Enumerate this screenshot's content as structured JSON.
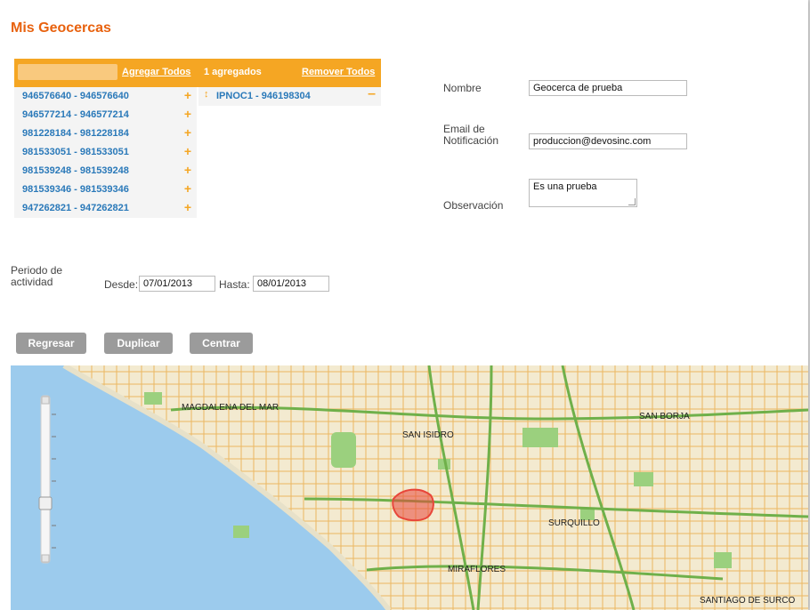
{
  "page_title": "Mis Geocercas",
  "picker": {
    "add_all": "Agregar Todos",
    "count": "1 agregados",
    "remove_all": "Remover Todos",
    "available": [
      "946576640 - 946576640",
      "946577214 - 946577214",
      "981228184 - 981228184",
      "981533051 - 981533051",
      "981539248 - 981539248",
      "981539346 - 981539346",
      "947262821 - 947262821"
    ],
    "selected": [
      "IPNOC1 - 946198304"
    ],
    "add_icon": "+",
    "remove_icon": "–",
    "move_icon": "↕",
    "accent_color": "#f5a623",
    "link_color": "#2a79b9"
  },
  "form": {
    "name_label": "Nombre",
    "name_value": "Geocerca de prueba",
    "email_label_1": "Email de",
    "email_label_2": "Notificación",
    "email_value": "produccion@devosinc.com",
    "obs_label": "Observación",
    "obs_value": "Es una prueba"
  },
  "period": {
    "label_1": "Periodo de",
    "label_2": "actividad",
    "from_label": "Desde:",
    "from_value": "07/01/2013",
    "to_label": "Hasta:",
    "to_value": "08/01/2013"
  },
  "buttons": {
    "back": "Regresar",
    "duplicate": "Duplicar",
    "center": "Centrar"
  },
  "map": {
    "labels": {
      "magdalena": "MAGDALENA DEL MAR",
      "san_isidro": "SAN ISIDRO",
      "san_borja": "SAN BORJA",
      "surquillo": "SURQUILLO",
      "miraflores": "MIRAFLORES",
      "surco": "SANTIAGO DE SURCO"
    },
    "zoom_level": 0.75,
    "geofence_color": "#e8463a",
    "sea_color": "#9ccbed",
    "land_color": "#f3ead0",
    "road_color": "#e9a53c",
    "park_color": "#9bd07e"
  }
}
